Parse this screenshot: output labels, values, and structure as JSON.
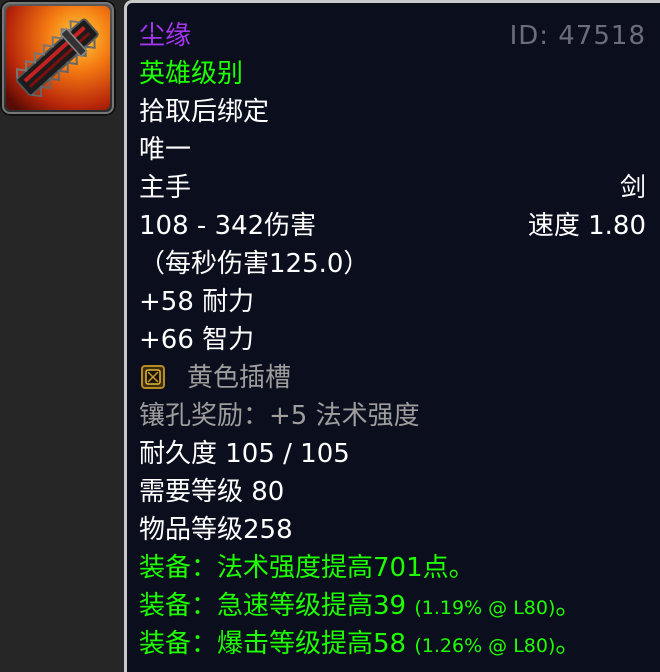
{
  "item": {
    "icon": "sword-item-icon",
    "name": "尘缘",
    "id_label": "ID: 47518",
    "quality": "英雄级别",
    "bind": "拾取后绑定",
    "unique": "唯一",
    "slot": "主手",
    "type": "剑",
    "damage": "108 - 342伤害",
    "speed": "速度 1.80",
    "dps": "（每秒伤害125.0）",
    "stats": [
      "+58 耐力",
      "+66 智力"
    ],
    "socket": {
      "icon": "yellow-socket-icon",
      "label": "黄色插槽"
    },
    "socket_bonus": "镶孔奖励：+5 法术强度",
    "durability": "耐久度 105 / 105",
    "required_level": "需要等级 80",
    "item_level": "物品等级258",
    "equip": [
      {
        "prefix": "装备：",
        "text": "法术强度提高701点。",
        "extra": "",
        "end": ""
      },
      {
        "prefix": "装备：",
        "text": "急速等级提高39",
        "extra": "(1.19% @ L80)",
        "end": "。"
      },
      {
        "prefix": "装备：",
        "text": "爆击等级提高58",
        "extra": "(1.26% @ L80)",
        "end": "。"
      }
    ]
  },
  "colors": {
    "epic": "#a335ee",
    "uncommon": "#1eff00",
    "gray": "#9d9d9d",
    "background": "#0b0e1c"
  }
}
